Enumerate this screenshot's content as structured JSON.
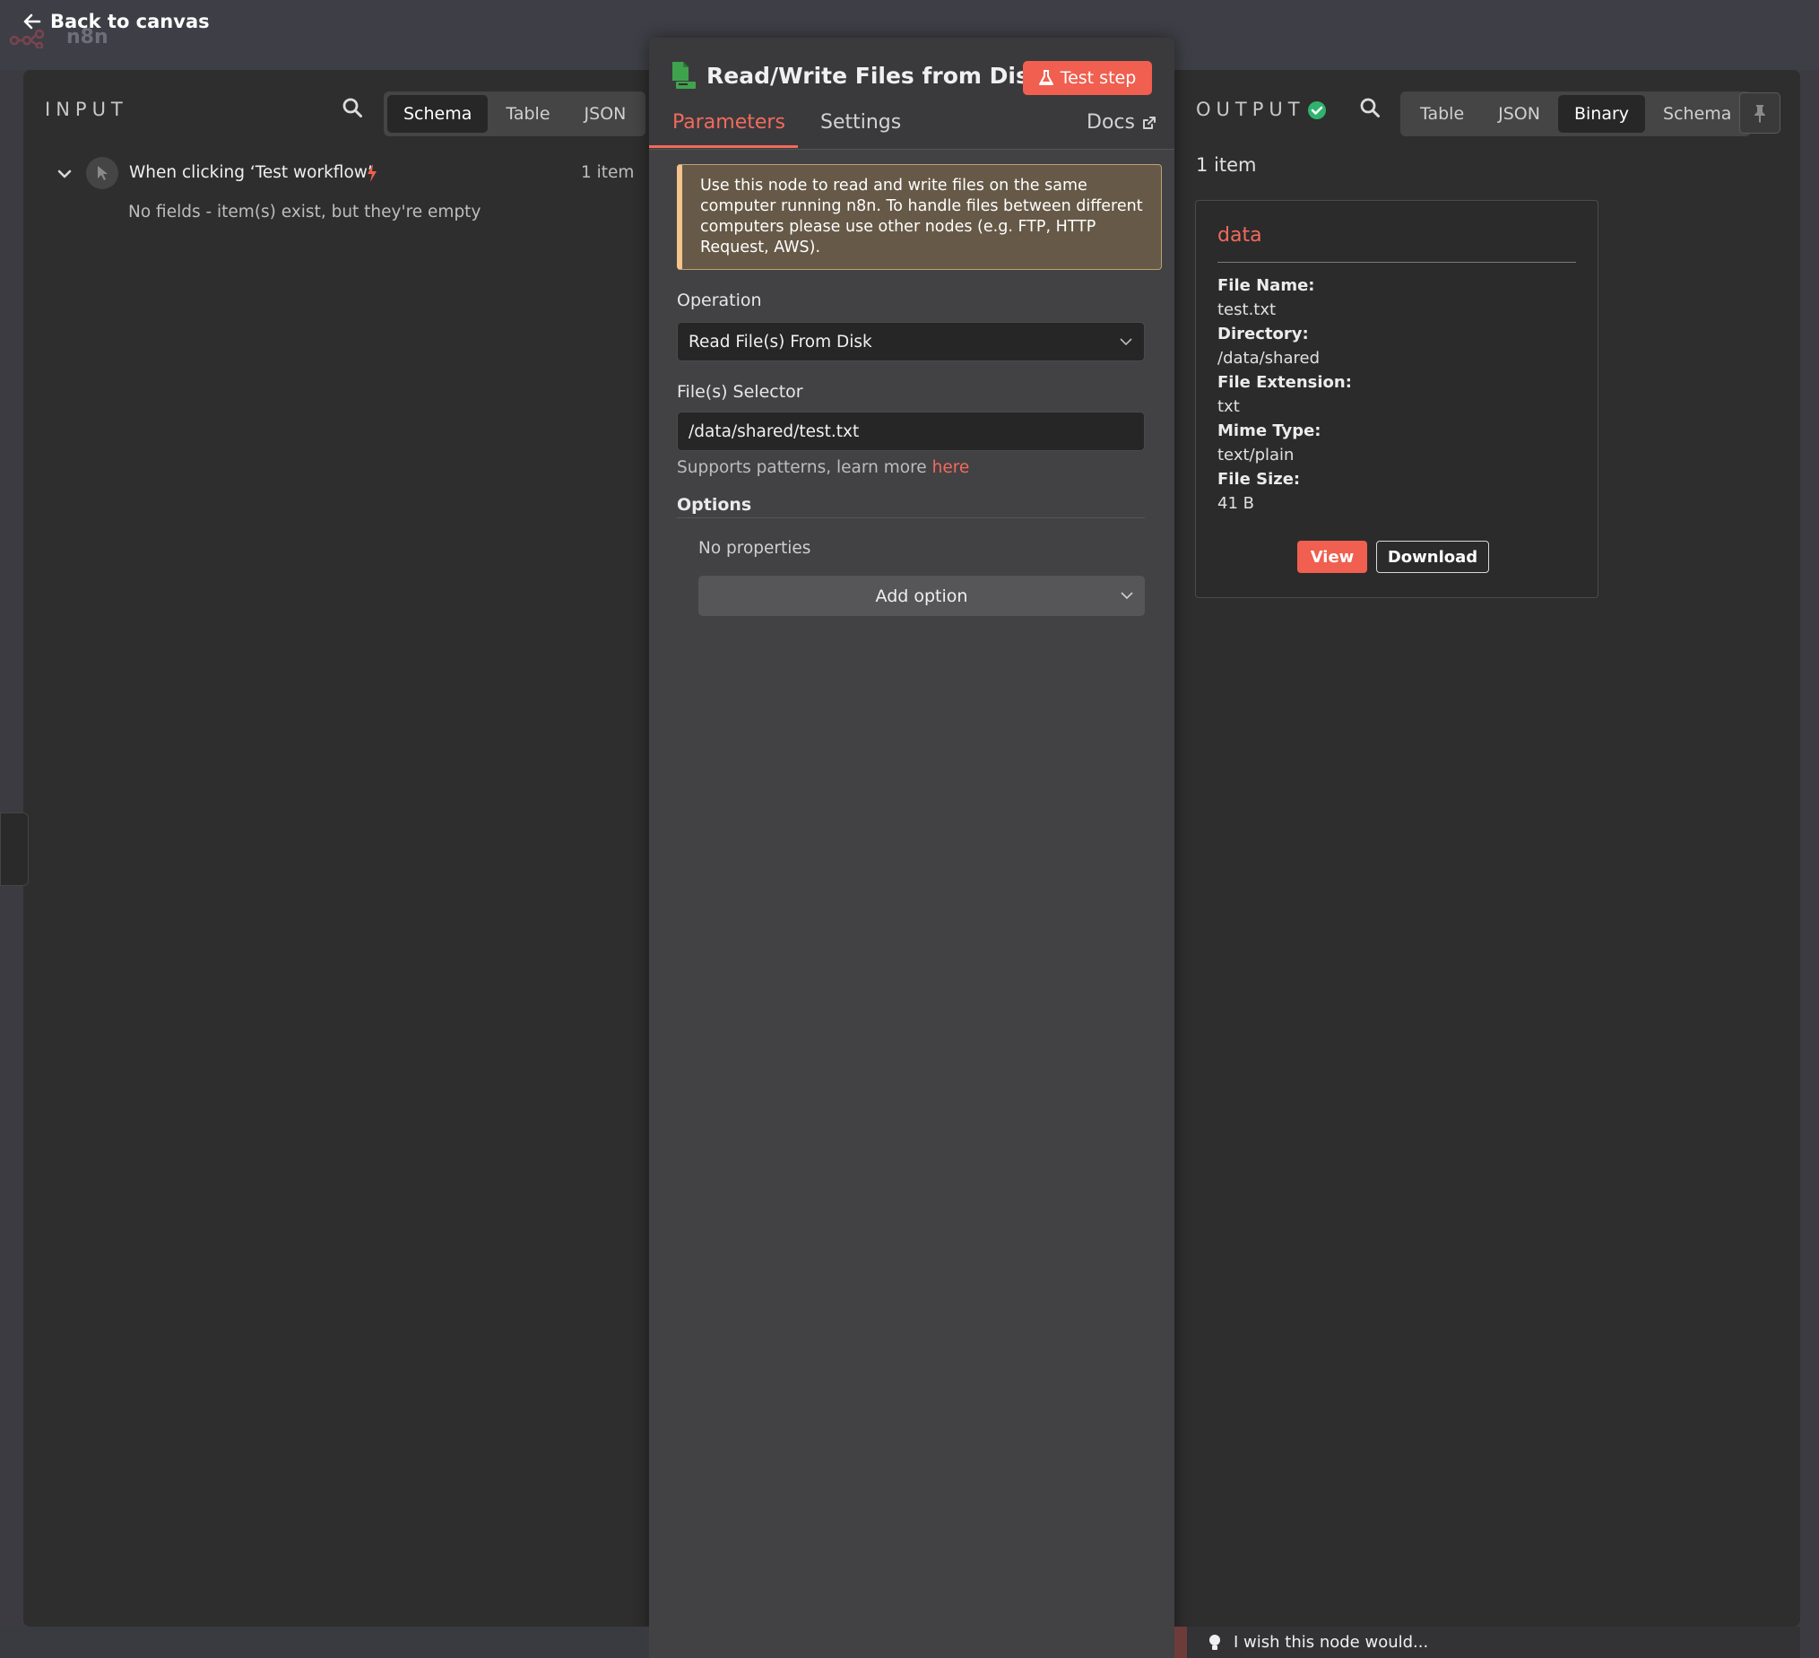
{
  "header": {
    "back_label": "Back to canvas",
    "brand": "n8n"
  },
  "input_panel": {
    "title": "INPUT",
    "view_tabs": [
      "Schema",
      "Table",
      "JSON"
    ],
    "active_tab": "Schema",
    "trigger_name": "When clicking ‘Test workflow’",
    "item_count": "1 item",
    "empty_message": "No fields - item(s) exist, but they're empty"
  },
  "node": {
    "title": "Read/Write Files from Disk",
    "test_button": "Test step",
    "tabs": {
      "parameters": "Parameters",
      "settings": "Settings",
      "docs": "Docs"
    },
    "notice": "Use this node to read and write files on the same computer running n8n. To handle files between different computers please use other nodes (e.g. FTP, HTTP Request, AWS).",
    "operation_label": "Operation",
    "operation_value": "Read File(s) From Disk",
    "selector_label": "File(s) Selector",
    "selector_value": "/data/shared/test.txt",
    "selector_hint": "Supports patterns, learn more",
    "selector_hint_link": "here",
    "options_label": "Options",
    "no_properties": "No properties",
    "add_option": "Add option"
  },
  "output_panel": {
    "title": "OUTPUT",
    "view_tabs": [
      "Table",
      "JSON",
      "Binary",
      "Schema"
    ],
    "active_tab": "Binary",
    "item_count": "1 item",
    "binary": {
      "key": "data",
      "fields": [
        {
          "label": "File Name:",
          "value": "test.txt"
        },
        {
          "label": "Directory:",
          "value": "/data/shared"
        },
        {
          "label": "File Extension:",
          "value": "txt"
        },
        {
          "label": "Mime Type:",
          "value": "text/plain"
        },
        {
          "label": "File Size:",
          "value": "41 B"
        }
      ],
      "view_label": "View",
      "download_label": "Download"
    }
  },
  "feedback": {
    "text": "I wish this node would..."
  },
  "colors": {
    "accent": "#f26a5c",
    "success": "#2fb36f",
    "node_icon": "#3fa34d"
  }
}
